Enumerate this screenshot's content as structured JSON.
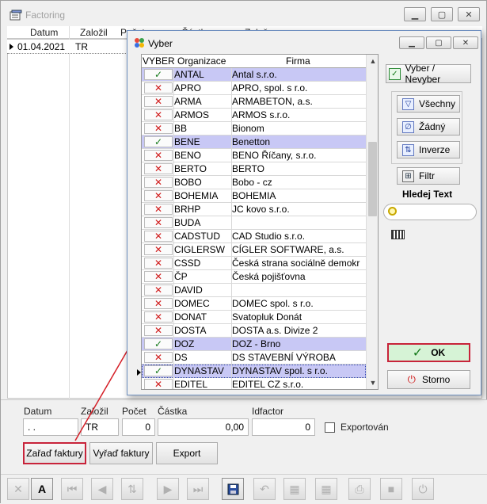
{
  "main": {
    "title": "Factoring",
    "grid": {
      "columns": [
        "Datum",
        "Založil",
        "Počet",
        "Částka",
        "Založeno"
      ],
      "rows": [
        {
          "datum": "01.04.2021",
          "zalozil": "TR"
        }
      ]
    },
    "form": {
      "labels": {
        "datum": "Datum",
        "zalozil": "Založil",
        "pocet": "Počet",
        "castka": "Částka",
        "idfactor": "Idfactor"
      },
      "values": {
        "datum": " . .",
        "zalozil": "TR",
        "pocet": "0",
        "castka": "0,00",
        "idfactor": "0"
      },
      "exportovan_label": "Exportován",
      "exportovan_checked": false
    },
    "buttons": {
      "zarad": "Zařaď faktury",
      "vyrad": "Vyřaď faktury",
      "export": "Export"
    }
  },
  "dialog": {
    "title": "Vyber",
    "columns": {
      "vyber": "VYBER",
      "organizace": "Organizace",
      "firma": "Firma"
    },
    "rows": [
      {
        "org": "ANTAL",
        "firma": "Antal s.r.o.",
        "checked": true
      },
      {
        "org": "APRO",
        "firma": "APRO, spol. s r.o.",
        "checked": false
      },
      {
        "org": "ARMA",
        "firma": "ARMABETON, a.s.",
        "checked": false
      },
      {
        "org": "ARMOS",
        "firma": "ARMOS s.r.o.",
        "checked": false
      },
      {
        "org": "BB",
        "firma": "Bionom",
        "checked": false
      },
      {
        "org": "BENE",
        "firma": "Benetton",
        "checked": true
      },
      {
        "org": "BENO",
        "firma": "BENO Říčany, s.r.o.",
        "checked": false
      },
      {
        "org": "BERTO",
        "firma": "BERTO",
        "checked": false
      },
      {
        "org": "BOBO",
        "firma": "Bobo - cz",
        "checked": false
      },
      {
        "org": "BOHEMIA",
        "firma": "BOHEMIA",
        "checked": false
      },
      {
        "org": "BRHP",
        "firma": "JC kovo s.r.o.",
        "checked": false
      },
      {
        "org": "BUDA",
        "firma": "",
        "checked": false
      },
      {
        "org": "CADSTUD",
        "firma": "CAD Studio s.r.o.",
        "checked": false
      },
      {
        "org": "CIGLERSW",
        "firma": "CÍGLER SOFTWARE, a.s.",
        "checked": false
      },
      {
        "org": "CSSD",
        "firma": "Česká strana sociálně demokr",
        "checked": false
      },
      {
        "org": "ČP",
        "firma": "Česká pojišťovna",
        "checked": false
      },
      {
        "org": "DAVID",
        "firma": "",
        "checked": false
      },
      {
        "org": "DOMEC",
        "firma": "DOMEC spol. s r.o.",
        "checked": false
      },
      {
        "org": "DONAT",
        "firma": "Svatopluk Donát",
        "checked": false
      },
      {
        "org": "DOSTA",
        "firma": "DOSTA a.s. Divize 2",
        "checked": false
      },
      {
        "org": "DOZ",
        "firma": "DOZ - Brno",
        "checked": true
      },
      {
        "org": "DS",
        "firma": "DS STAVEBNÍ VÝROBA",
        "checked": false
      },
      {
        "org": "DYNASTAV",
        "firma": "DYNASTAV spol. s r.o.",
        "checked": true,
        "current": true
      },
      {
        "org": "EDITEL",
        "firma": "EDITEL CZ s.r.o.",
        "checked": false
      }
    ],
    "buttons": {
      "vyber_nevyber": "Vyber / Nevyber",
      "vsechny": "Všechny",
      "zadny": "Žádný",
      "inverze": "Inverze",
      "filtr": "Filtr",
      "hledej_label": "Hledej Text",
      "ok": "OK",
      "storno": "Storno"
    },
    "search_value": ""
  },
  "colors": {
    "selected_row": "#c8c8f5",
    "check_on": "#177a1c",
    "check_off": "#d01b1b",
    "highlight_border": "#c8233a"
  }
}
